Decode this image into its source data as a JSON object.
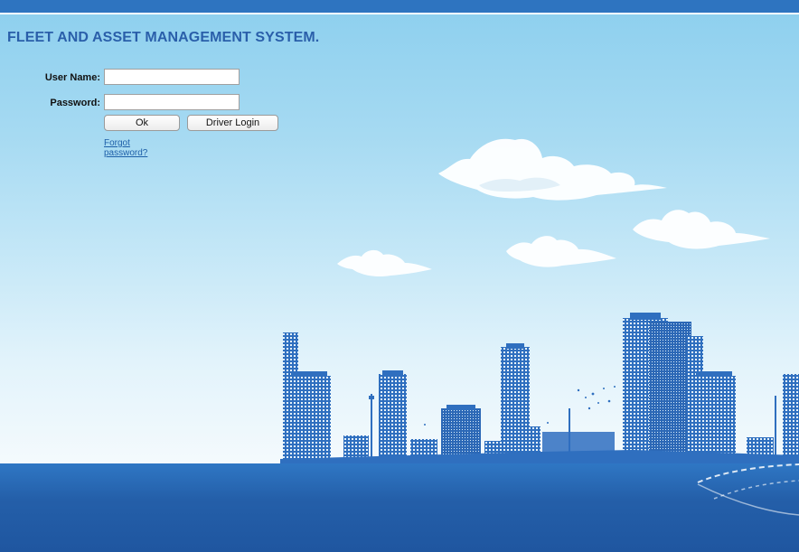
{
  "header": {
    "title": "FLEET AND ASSET MANAGEMENT SYSTEM."
  },
  "login": {
    "username_label": "User Name:",
    "username_value": "",
    "password_label": "Password:",
    "password_value": "",
    "ok_label": "Ok",
    "driver_login_label": "Driver Login",
    "forgot_password_label": "Forgot password?"
  },
  "colors": {
    "top_bar": "#2e74c0",
    "title_text": "#2a5faa",
    "sky": "#8ccfee",
    "ground": "#245fa9",
    "skyline": "#2f6fbf"
  },
  "decorations": {
    "background_icon": "city-skyline-illustration",
    "cloud_icon": "cloud-icon"
  }
}
